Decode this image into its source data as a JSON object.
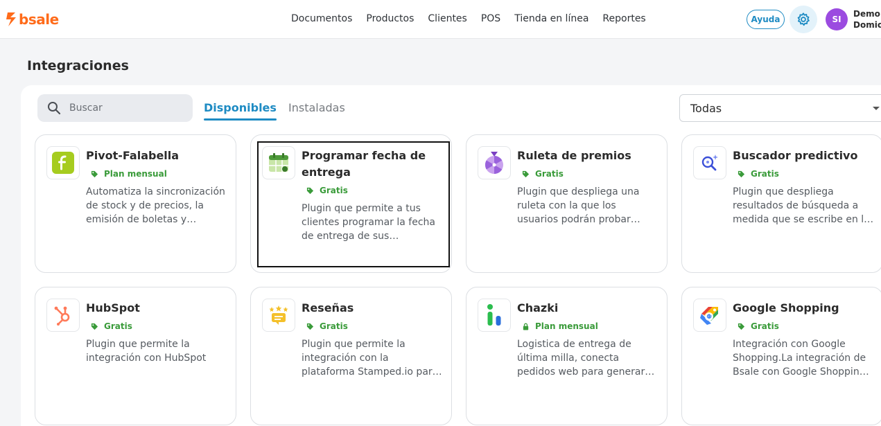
{
  "header": {
    "logo_text": "bsale",
    "nav": [
      "Documentos",
      "Productos",
      "Clientes",
      "POS",
      "Tienda en línea",
      "Reportes"
    ],
    "help_label": "Ayuda",
    "avatar_initials": "SI",
    "user_name_line1": "Demo I",
    "user_name_line2": "Domici"
  },
  "page": {
    "title": "Integraciones"
  },
  "toolbar": {
    "search_placeholder": "Buscar",
    "tab_available": "Disponibles",
    "tab_installed": "Instaladas",
    "filter_selected": "Todas"
  },
  "cards": [
    {
      "title": "Pivot-Falabella",
      "badge": "Plan mensual",
      "desc": "Automatiza la sincronización de stock y de precios, la emisión de boletas y facturas en Falabella"
    },
    {
      "title": "Programar fecha de entrega",
      "badge": "Gratis",
      "desc": "Plugin que permite a tus clientes programar la fecha de entrega de sus pedidos.Para más información"
    },
    {
      "title": "Ruleta de premios",
      "badge": "Gratis",
      "desc": "Plugin que despliega una ruleta con la que los usuarios podrán probar suerte y ganar premios"
    },
    {
      "title": "Buscador predictivo",
      "badge": "Gratis",
      "desc": "Plugin que despliega resultados de búsqueda a medida que se escribe en la barra"
    },
    {
      "title": "HubSpot",
      "badge": "Gratis",
      "desc": "Plugin que permite la integración con HubSpot"
    },
    {
      "title": "Reseñas",
      "badge": "Gratis",
      "desc": "Plugin que permite la integración con la plataforma Stamped.io para recibir reseñas"
    },
    {
      "title": "Chazki",
      "badge": "Plan mensual",
      "desc": "Logistica de entrega de última milla, conecta pedidos web para generar solicitudes de envío"
    },
    {
      "title": "Google Shopping",
      "badge": "Gratis",
      "desc": "Integración con Google Shopping.La integración de Bsale con Google Shopping permite"
    }
  ],
  "colors": {
    "brand": "#ff6b1a",
    "accent": "#1e8bc3",
    "badge_green": "#3a9b3a",
    "avatar": "#9b4be0"
  },
  "icons": [
    "falabella-icon",
    "calendar-icon",
    "roulette-icon",
    "predictive-search-icon",
    "hubspot-icon",
    "reviews-icon",
    "chazki-icon",
    "google-shopping-icon"
  ]
}
